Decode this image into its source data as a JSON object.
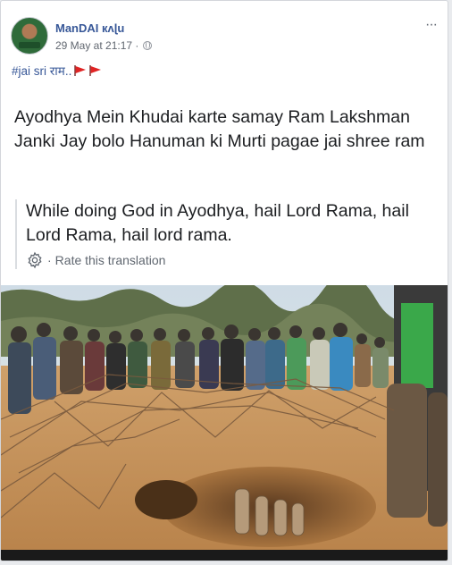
{
  "post": {
    "author": "ManDAI кʌɭu",
    "timestamp": "29 May at 21:17 ·",
    "more_label": "···",
    "hashtag": "#jai sri राम..",
    "original_text": "Ayodhya Mein Khudai karte samay Ram Lakshman Janki Jay bolo Hanuman ki Murti pagae jai shree ram",
    "translation_text": "While doing God in Ayodhya, hail Lord Rama, hail Lord Rama, hail lord rama.",
    "rate_translation": "Rate this translation",
    "rate_separator": "·"
  },
  "icons": {
    "privacy": "globe-icon",
    "menu": "more-icon",
    "flags": "triangular-flag-icon",
    "settings": "gear-icon"
  },
  "colors": {
    "link": "#385898",
    "text": "#1c1e21",
    "secondary": "#606770",
    "flag": "#e02424"
  }
}
